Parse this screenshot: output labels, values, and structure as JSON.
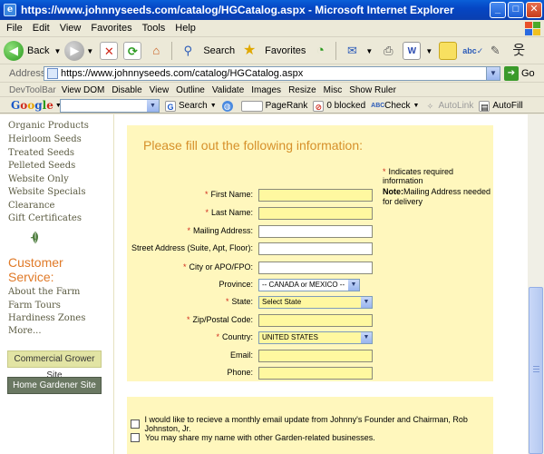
{
  "window": {
    "title": "https://www.johnnyseeds.com/catalog/HGCatalog.aspx - Microsoft Internet Explorer",
    "min_glyph": "_",
    "max_glyph": "□",
    "close_glyph": "✕"
  },
  "menubar": {
    "items": [
      "File",
      "Edit",
      "View",
      "Favorites",
      "Tools",
      "Help"
    ]
  },
  "toolbar": {
    "back_label": "Back",
    "search_label": "Search",
    "favorites_label": "Favorites"
  },
  "address": {
    "label": "Address",
    "url": "https://www.johnnyseeds.com/catalog/HGCatalog.aspx",
    "go_label": "Go"
  },
  "devtoolbar": {
    "title": "DevToolBar",
    "items": [
      "View DOM",
      "Disable",
      "View",
      "Outline",
      "Validate",
      "Images",
      "Resize",
      "Misc",
      "Show Ruler"
    ]
  },
  "googlebar": {
    "logo_letters": [
      "G",
      "o",
      "o",
      "g",
      "l",
      "e"
    ],
    "search_label": "Search",
    "pagerank_label": "PageRank",
    "blocked_label": "0 blocked",
    "check_label": "Check",
    "autolink_label": "AutoLink",
    "autofill_label": "AutoFill"
  },
  "sidebar": {
    "links": [
      "Organic Products",
      "Heirloom Seeds",
      "Treated Seeds",
      "Pelleted Seeds",
      "Website Only",
      "Website Specials",
      "Clearance",
      "Gift Certificates"
    ],
    "customer_service_title_line1": "Customer",
    "customer_service_title_line2": "Service:",
    "service_links": [
      "About the Farm",
      "Farm Tours",
      "Hardiness Zones",
      "More..."
    ],
    "commercial_button": "Commercial Grower Site",
    "home_button": "Home Gardener Site"
  },
  "form": {
    "title": "Please fill out the following information:",
    "required_marker": "*",
    "fields": {
      "first_name": "First Name:",
      "last_name": "Last Name:",
      "mailing_address": "Mailing Address:",
      "street_address": "Street Address (Suite, Apt, Floor):",
      "city": "City or APO/FPO:",
      "province": "Province:",
      "state": "State:",
      "zip": "Zip/Postal Code:",
      "country": "Country:",
      "email": "Email:",
      "phone": "Phone:"
    },
    "province_value": "-- CANADA or MEXICO --",
    "state_value": "Select State",
    "country_value": "UNITED STATES",
    "required_note": "Indicates required information",
    "note_label": "Note:",
    "note_text": "Mailing Address needed for delivery"
  },
  "options": {
    "monthly_email": "I would like to recieve a monthly email update from Johnny's Founder and Chairman, Rob Johnston, Jr.",
    "share_name": "You may share my name with other Garden-related businesses."
  }
}
